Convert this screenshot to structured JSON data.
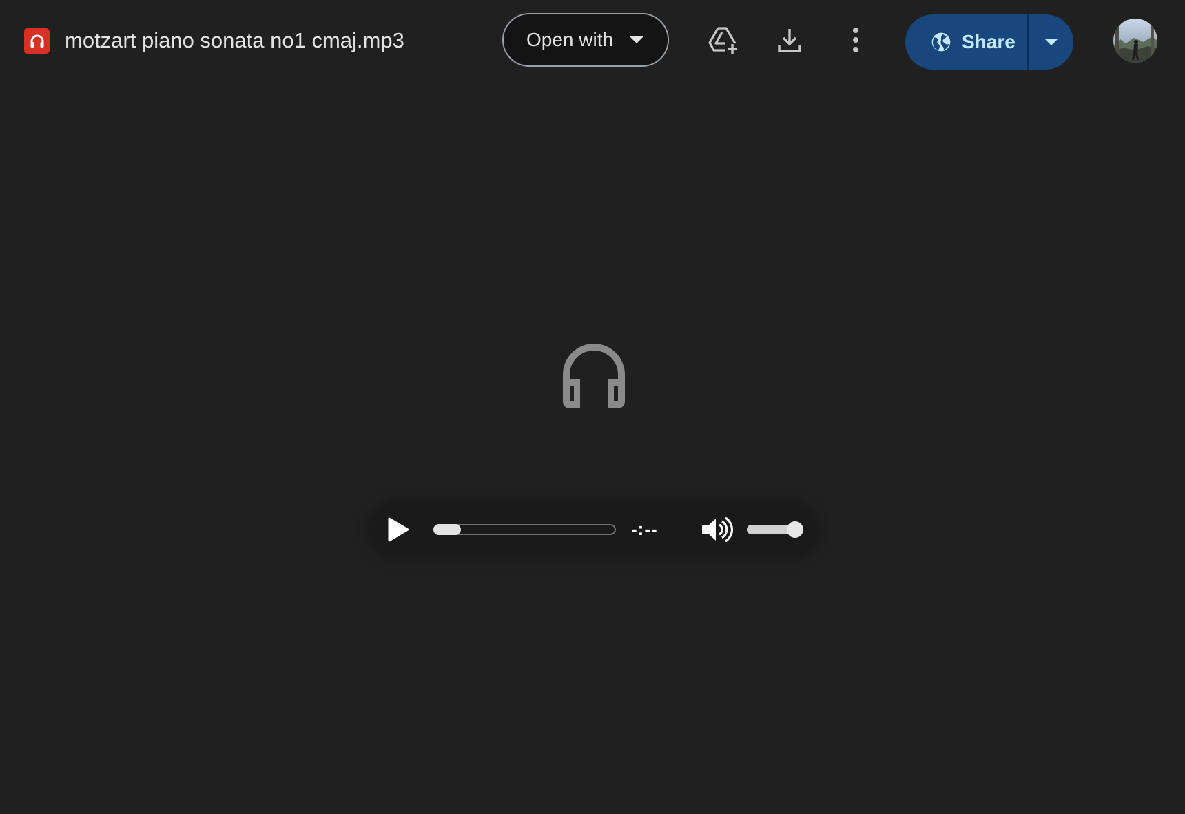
{
  "header": {
    "file_icon": "headphones-icon",
    "file_name": "motzart piano sonata no1 cmaj.mp3",
    "open_with_label": "Open with",
    "add_shortcut_icon": "add-to-drive-icon",
    "download_icon": "download-icon",
    "more_icon": "more-vert-icon",
    "share_label": "Share",
    "share_icon": "globe-icon",
    "share_dropdown_icon": "caret-down-icon",
    "avatar_icon": "user-avatar"
  },
  "player": {
    "preview_icon": "headphones-icon",
    "play_icon": "play-icon",
    "time_display": "-:--",
    "progress_fraction": 0.0,
    "volume_icon": "volume-up-icon",
    "volume_fraction": 1.0
  },
  "colors": {
    "background": "#202020",
    "file_icon_bg": "#d93025",
    "share_bg": "#17477c",
    "share_text": "#c2e7ff"
  }
}
